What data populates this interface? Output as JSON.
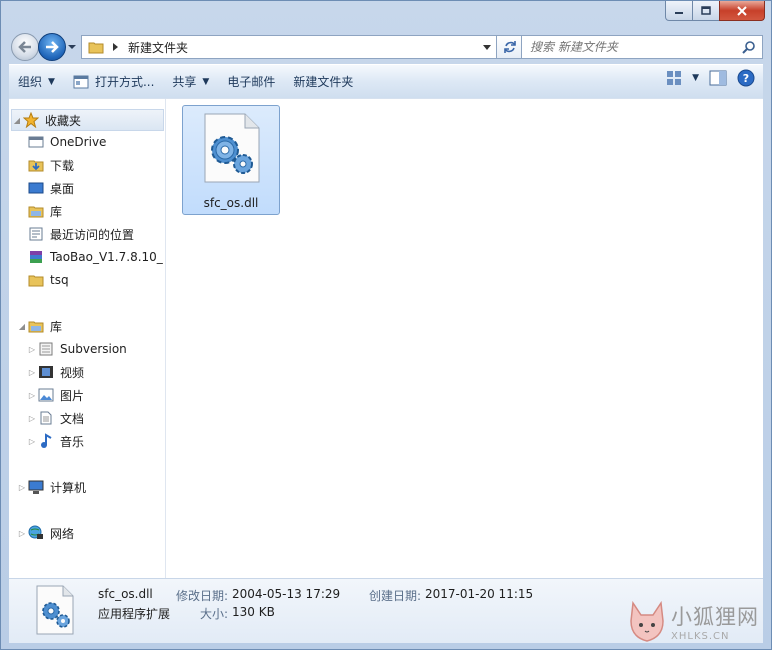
{
  "window": {
    "caption_buttons": [
      "minimize",
      "maximize",
      "close"
    ]
  },
  "address": {
    "path": "新建文件夹",
    "search_placeholder": "搜索 新建文件夹"
  },
  "toolbar": {
    "organize": "组织",
    "open_with": "打开方式...",
    "share": "共享",
    "email": "电子邮件",
    "new_folder": "新建文件夹"
  },
  "nav": {
    "favorites": "收藏夹",
    "fav_items": [
      "OneDrive",
      "下载",
      "桌面",
      "库",
      "最近访问的位置",
      "TaoBao_V1.7.8.10_",
      "tsq"
    ],
    "libraries": "库",
    "lib_items": [
      "Subversion",
      "视频",
      "图片",
      "文档",
      "音乐"
    ],
    "computer": "计算机",
    "network": "网络"
  },
  "files": [
    {
      "name": "sfc_os.dll",
      "icon": "gear-file-icon"
    }
  ],
  "details": {
    "name": "sfc_os.dll",
    "type": "应用程序扩展",
    "modified_label": "修改日期:",
    "modified": "2004-05-13 17:29",
    "created_label": "创建日期:",
    "created": "2017-01-20 11:15",
    "size_label": "大小:",
    "size": "130 KB"
  },
  "watermark": {
    "title": "小狐狸网",
    "url": "XHLKS.CN"
  }
}
